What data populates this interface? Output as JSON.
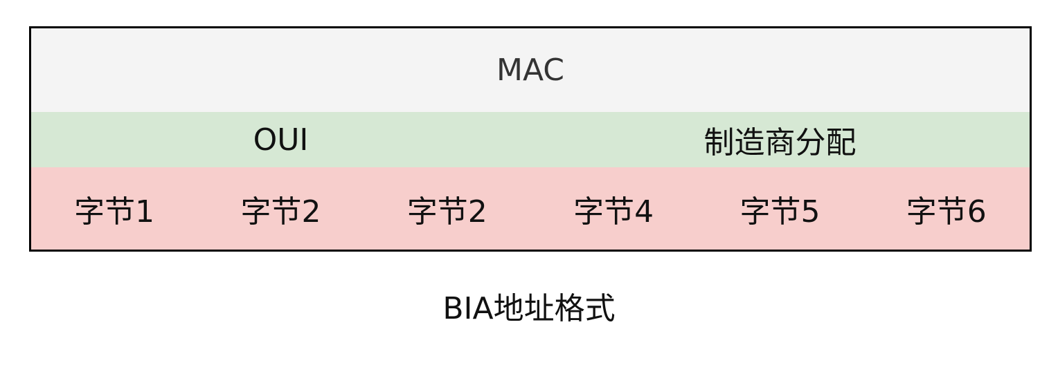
{
  "diagram": {
    "header": "MAC",
    "segments": [
      {
        "label": "OUI"
      },
      {
        "label": "制造商分配"
      }
    ],
    "bytes": [
      {
        "label": "字节1"
      },
      {
        "label": "字节2"
      },
      {
        "label": "字节2"
      },
      {
        "label": "字节4"
      },
      {
        "label": "字节5"
      },
      {
        "label": "字节6"
      }
    ],
    "caption": "BIA地址格式"
  },
  "colors": {
    "header_bg": "#f4f4f4",
    "segment_bg": "#d6e8d4",
    "bytes_bg": "#f7cecc",
    "border": "#000000"
  }
}
